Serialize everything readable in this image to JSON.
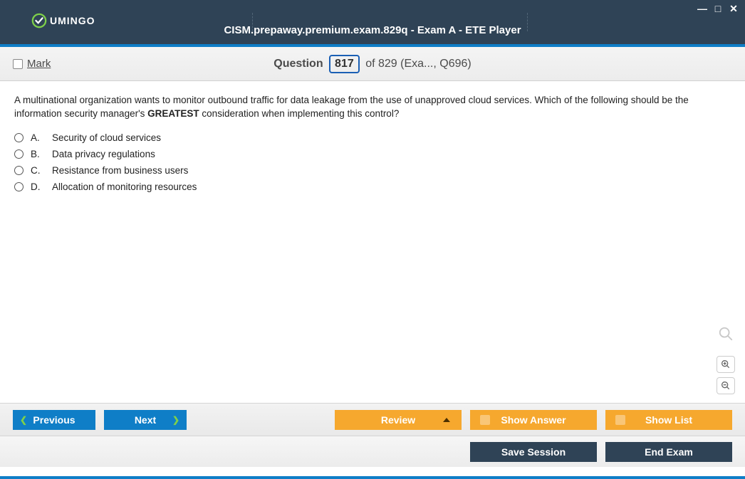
{
  "titlebar": {
    "logo_text": "UMINGO",
    "title": "CISM.prepaway.premium.exam.829q - Exam A - ETE Player"
  },
  "qbar": {
    "mark_label": "Mark",
    "question_word": "Question",
    "current": "817",
    "total_of": "of 829",
    "suffix": "(Exa..., Q696)"
  },
  "question": {
    "text_pre": "A multinational organization wants to monitor outbound traffic for data leakage from the use of unapproved cloud services. Which of the following should be the information security manager's ",
    "emph": "GREATEST",
    "text_post": " consideration when implementing this control?"
  },
  "answers": [
    {
      "letter": "A.",
      "text": "Security of cloud services"
    },
    {
      "letter": "B.",
      "text": "Data privacy regulations"
    },
    {
      "letter": "C.",
      "text": "Resistance from business users"
    },
    {
      "letter": "D.",
      "text": "Allocation of monitoring resources"
    }
  ],
  "nav": {
    "previous": "Previous",
    "next": "Next",
    "review": "Review",
    "show_answer": "Show Answer",
    "show_list": "Show List"
  },
  "session": {
    "save": "Save Session",
    "end": "End Exam"
  }
}
